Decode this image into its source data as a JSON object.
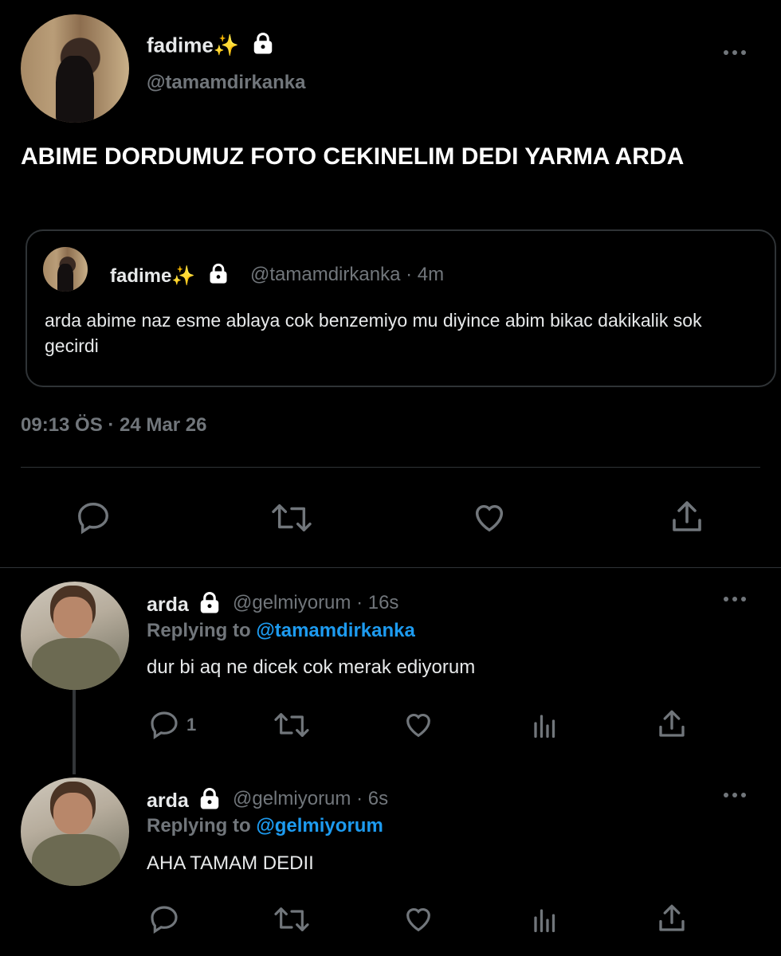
{
  "main_tweet": {
    "name": "fadime✨",
    "handle": "@tamamdirkanka",
    "text": "ABIME DORDUMUZ FOTO CEKINELIM DEDI YARMA ARDA",
    "timestamp": "09:13 ÖS · 24 Mar 26",
    "quoted": {
      "name": "fadime✨",
      "handle": "@tamamdirkanka",
      "time": "· 4m",
      "text": "arda abime naz esme ablaya cok benzemiyo mu diyince abim bikac dakikalik sok gecirdi"
    }
  },
  "replies": [
    {
      "name": "arda",
      "handle": "@gelmiyorum",
      "time": "· 16s",
      "replying_prefix": "Replying to",
      "replying_to": "@tamamdirkanka",
      "text": "dur bi aq ne dicek cok merak ediyorum",
      "reply_count": "1"
    },
    {
      "name": "arda",
      "handle": "@gelmiyorum",
      "time": "· 6s",
      "replying_prefix": "Replying to",
      "replying_to": "@gelmiyorum",
      "text": "AHA TAMAM DEDII",
      "reply_count": ""
    }
  ],
  "colors": {
    "background": "#000000",
    "text": "#e7e9ea",
    "muted": "#71767b",
    "accent": "#1d9bf0",
    "divider": "#2f3336"
  },
  "icons": [
    "more-icon",
    "lock-icon",
    "reply-icon",
    "retweet-icon",
    "like-icon",
    "share-icon",
    "analytics-icon"
  ]
}
